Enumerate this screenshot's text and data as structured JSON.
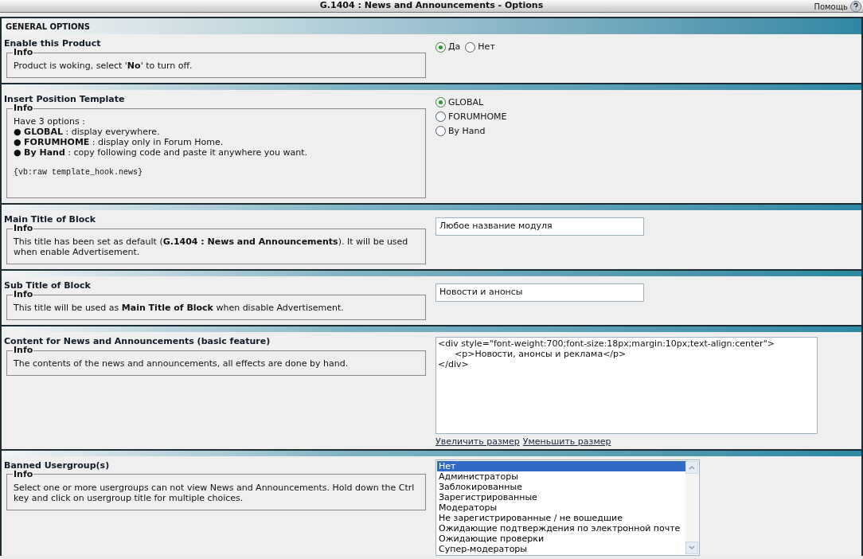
{
  "window": {
    "title": "G.1404 : News and Announcements - Options",
    "help": "Помощь"
  },
  "section": {
    "title": "GENERAL OPTIONS"
  },
  "settings": [
    {
      "kind": "radio-inline",
      "title": "Enable this Product",
      "info_legend": "Info",
      "info": [
        "Product is woking, select '**No**' to turn off."
      ],
      "options": [
        {
          "label": "Да",
          "selected": true
        },
        {
          "label": "Нет",
          "selected": false
        }
      ]
    },
    {
      "kind": "radio-list",
      "title": "Insert Position Template",
      "info_legend": "Info",
      "info": [
        "Have 3 options :",
        "● **GLOBAL** : display everywhere.",
        "● **FORUMHOME** : display only in Forum Home.",
        "● **By Hand** : copy following code and paste it anywhere you want."
      ],
      "code": "{vb:raw template_hook.news}",
      "options": [
        {
          "label": "GLOBAL",
          "selected": true
        },
        {
          "label": "FORUMHOME",
          "selected": false
        },
        {
          "label": "By Hand",
          "selected": false
        }
      ]
    },
    {
      "kind": "text",
      "title": "Main Title of Block",
      "info_legend": "Info",
      "info": [
        "This title has been set as default (**G.1404 : News and Announcements**). It will be used when enable Advertisement."
      ],
      "value": "Любое название модуля"
    },
    {
      "kind": "text",
      "title": "Sub Title of Block",
      "info_legend": "Info",
      "info": [
        "This title will be used as **Main Title of Block** when disable Advertisement."
      ],
      "value": "Новости и анонсы"
    },
    {
      "kind": "textarea",
      "title": "Content for News and Announcements (basic feature)",
      "info_legend": "Info",
      "info": [
        "The contents of the news and announcements, all effects are done by hand."
      ],
      "value": "<div style=\"font-weight:700;font-size:18px;margin:10px;text-align:center\">\n\t<p>Новости, анонсы и реклама</p>\n</div>",
      "links": [
        "Увеличить размер",
        "Уменьшить размер"
      ]
    },
    {
      "kind": "multiselect",
      "title": "Banned Usergroup(s)",
      "info_legend": "Info",
      "info": [
        "Select one or more usergroups can not view News and Announcements. Hold down the Ctrl key and click on usergroup title for multiple choices."
      ],
      "options": [
        {
          "label": "Нет",
          "selected": true
        },
        {
          "label": "Администраторы",
          "selected": false
        },
        {
          "label": "Заблокированные",
          "selected": false
        },
        {
          "label": "Зарегистрированные",
          "selected": false
        },
        {
          "label": "Модераторы",
          "selected": false
        },
        {
          "label": "Не зарегистрированные / не вошедшие",
          "selected": false
        },
        {
          "label": "Ожидающие подтверждения по электронной почте",
          "selected": false
        },
        {
          "label": "Ожидающие проверки",
          "selected": false
        },
        {
          "label": "Супер-модераторы",
          "selected": false
        }
      ]
    }
  ]
}
